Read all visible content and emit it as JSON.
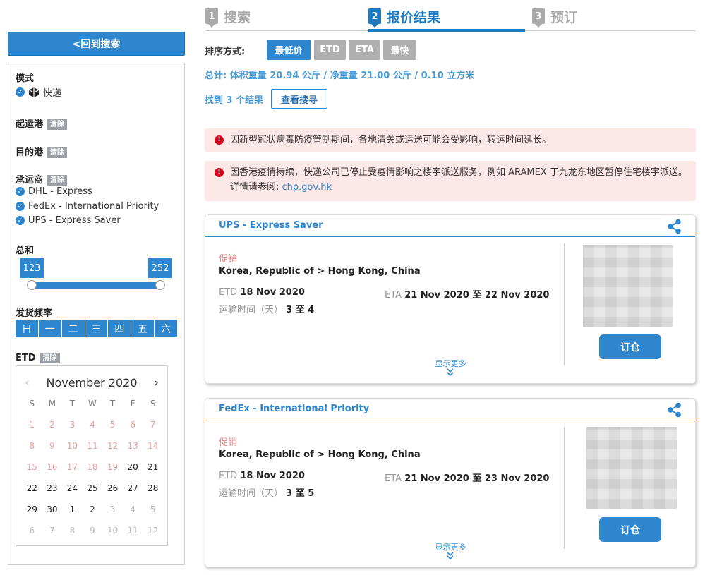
{
  "steps": [
    {
      "num": "1",
      "label": "搜索"
    },
    {
      "num": "2",
      "label": "报价结果"
    },
    {
      "num": "3",
      "label": "预订"
    }
  ],
  "sidebar": {
    "back_label": "<回到搜索",
    "mode_label": "模式",
    "mode_value": "快递",
    "origin_label": "起运港",
    "dest_label": "目的港",
    "carrier_label": "承运商",
    "clear_label": "清除",
    "carriers": [
      "DHL - Express",
      "FedEx - International Priority",
      "UPS - Express Saver"
    ],
    "total_label": "总和",
    "price_min": "123",
    "price_max": "252",
    "freq_label": "发货频率",
    "days": [
      "日",
      "一",
      "二",
      "三",
      "四",
      "五",
      "六"
    ],
    "etd_label": "ETD",
    "calendar": {
      "month": "November 2020",
      "dow": [
        "S",
        "M",
        "T",
        "W",
        "T",
        "F",
        "S"
      ],
      "cells": [
        "1",
        "2",
        "3",
        "4",
        "5",
        "6",
        "7",
        "8",
        "9",
        "10",
        "11",
        "12",
        "13",
        "14",
        "15",
        "16",
        "17",
        "18",
        "19",
        "20",
        "21",
        "22",
        "23",
        "24",
        "25",
        "26",
        "27",
        "28",
        "29",
        "30",
        "1",
        "2",
        "3",
        "4",
        "5",
        "6",
        "7",
        "8",
        "9",
        "10",
        "11",
        "12"
      ]
    }
  },
  "sort": {
    "label": "排序方式:",
    "options": [
      "最低价",
      "ETD",
      "ETA",
      "最快"
    ],
    "active": "最低价"
  },
  "summary": {
    "total": "总计: 体积重量 20.94 公斤 / 净重量 21.00 公斤 / 0.10 立方米",
    "found": "找到 3 个结果",
    "view_search": "查看搜寻"
  },
  "alerts": [
    {
      "text": "因新型冠状病毒防疫管制期间，各地清关或运送可能会受影响，转运时间延长。"
    },
    {
      "text": "因香港疫情持续，快递公司已停止受疫情影响之楼宇派送服务，例如 ARAMEX 于九龙东地区暂停住宅楼宇派送。详情请参阅: ",
      "link": "chp.gov.hk"
    }
  ],
  "results": [
    {
      "title": "UPS - Express Saver",
      "promo": "促销",
      "route": "Korea, Republic of > Hong Kong, China",
      "etd_label": "ETD",
      "etd": "18 Nov 2020",
      "eta_label": "ETA",
      "eta": "21 Nov 2020 至 22 Nov 2020",
      "transit_label": "运输时间（天）",
      "transit": "3 至 4",
      "book": "订仓",
      "more": "显示更多"
    },
    {
      "title": "FedEx - International Priority",
      "promo": "促销",
      "route": "Korea, Republic of > Hong Kong, China",
      "etd_label": "ETD",
      "etd": "18 Nov 2020",
      "eta_label": "ETA",
      "eta": "21 Nov 2020 至 23 Nov 2020",
      "transit_label": "运输时间（天）",
      "transit": "3 至 5",
      "book": "订仓",
      "more": "显示更多"
    }
  ],
  "colors": {
    "accent": "#2e86cf",
    "alert_bg": "#fde8e8",
    "promo": "#e88a8a"
  }
}
